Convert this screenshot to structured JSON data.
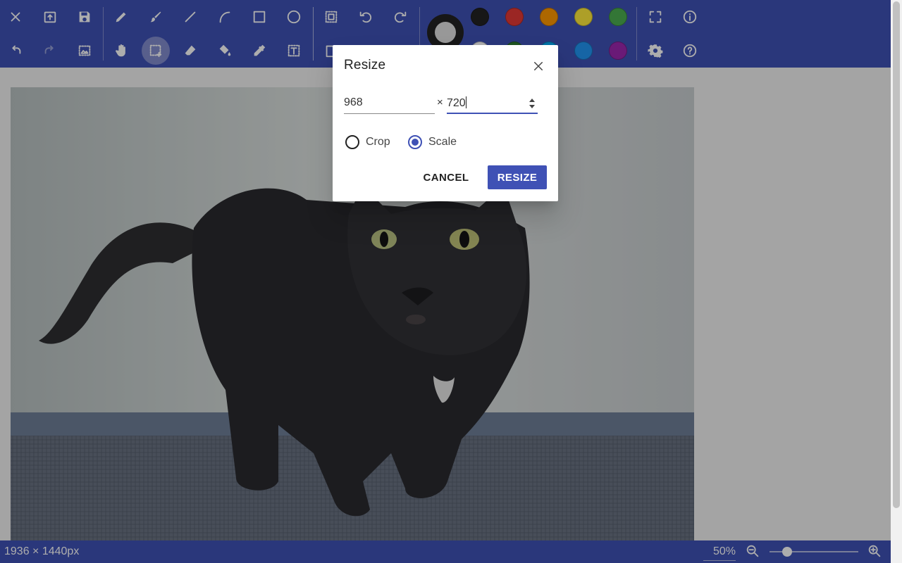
{
  "colors": {
    "primary": "#3f51b5",
    "current_color": "#e0e0e0",
    "palette_top": [
      "#222222",
      "#e53935",
      "#ff9800",
      "#ffeb3b",
      "#4caf50"
    ],
    "palette_bottom": [
      "#ffffff",
      "#2e7d32",
      "#03a9f4",
      "#2196f3",
      "#9c27b0"
    ]
  },
  "toolbar": {
    "top_row_icons": [
      "close-icon",
      "open-icon",
      "save-icon",
      "pencil-icon",
      "brush-icon",
      "line-icon",
      "curve-icon",
      "rectangle-icon",
      "ellipse-icon",
      "select-all-icon",
      "rotate-left-icon",
      "rotate-right-icon",
      "fullscreen-icon",
      "info-icon"
    ],
    "bottom_row_icons": [
      "undo-icon",
      "redo-icon",
      "resize-image-icon",
      "hand-icon",
      "select-icon",
      "eraser-icon",
      "fill-icon",
      "eyedropper-icon",
      "text-icon",
      "paste-icon",
      "settings-icon",
      "help-icon"
    ]
  },
  "status": {
    "dimensions": "1936 × 1440px",
    "zoom": "50%",
    "zoom_level": 0.2
  },
  "dialog": {
    "title": "Resize",
    "width_value": "968",
    "times_symbol": "×",
    "height_value": "720",
    "options": [
      "Crop",
      "Scale"
    ],
    "selected_option": "Scale",
    "cancel_label": "CANCEL",
    "resize_label": "RESIZE"
  }
}
